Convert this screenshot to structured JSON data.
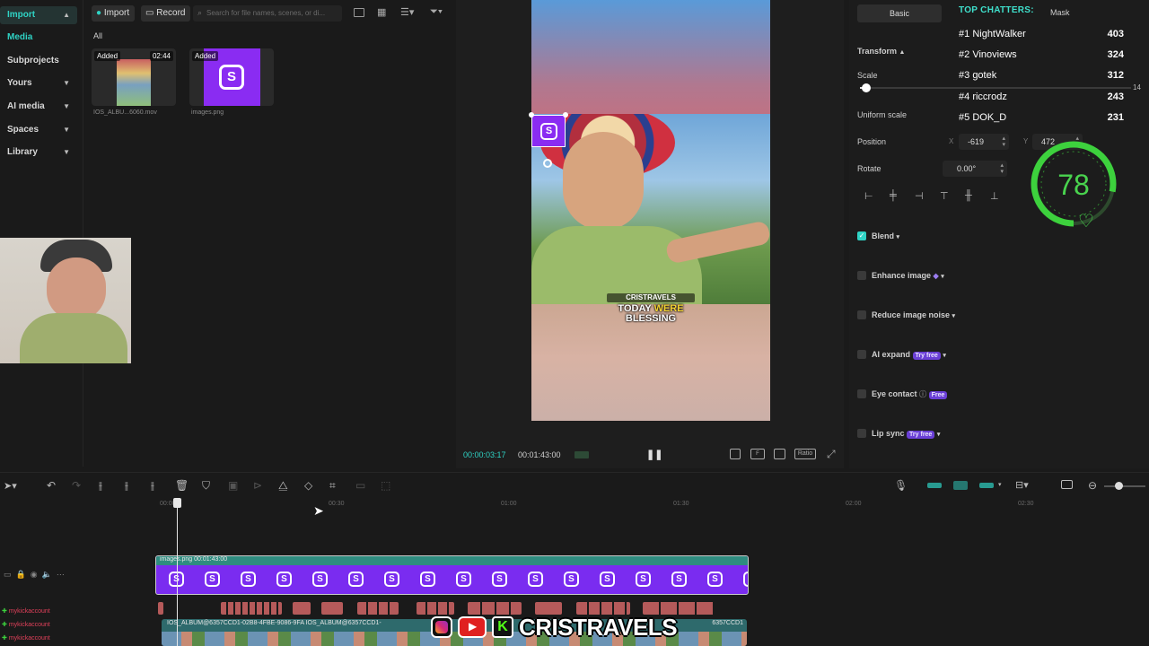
{
  "left_nav": {
    "items": [
      {
        "label": "Import",
        "active": true
      },
      {
        "label": "Media",
        "active": true
      },
      {
        "label": "Subprojects"
      },
      {
        "label": "Yours"
      },
      {
        "label": "AI media"
      },
      {
        "label": "Spaces"
      },
      {
        "label": "Library"
      }
    ]
  },
  "media": {
    "import_label": "Import",
    "record_label": "Record",
    "search_placeholder": "Search for file names, scenes, or di...",
    "filter_label": "All",
    "items": [
      {
        "badge": "Added",
        "duration": "02:44",
        "name": "IOS_ALBU...6060.mov"
      },
      {
        "badge": "Added",
        "duration": "",
        "name": "images.png"
      }
    ]
  },
  "preview": {
    "caption_handle": "CRISTRAVELS",
    "caption_line1a": "TODAY",
    "caption_line1b": "WERE",
    "caption_line2": "BLESSING",
    "current_time": "00:00:03:17",
    "total_time": "00:01:43:00",
    "ratio_label": "Ratio"
  },
  "properties": {
    "tabs": [
      "Basic",
      "Mask"
    ],
    "transform_label": "Transform",
    "scale_label": "Scale",
    "scale_value": "14",
    "uniform_scale_label": "Uniform scale",
    "position_label": "Position",
    "x_label": "X",
    "x_value": "-619",
    "y_label": "Y",
    "y_value": "472",
    "rotate_label": "Rotate",
    "rotate_value": "0.00°",
    "blend_label": "Blend",
    "enhance_label": "Enhance image",
    "noise_label": "Reduce image noise",
    "ai_expand_label": "AI expand",
    "ai_expand_tag": "Try free",
    "eye_label": "Eye contact",
    "eye_tag": "Free",
    "lip_label": "Lip sync",
    "lip_tag": "Try free"
  },
  "chatters": {
    "title": "TOP CHATTERS:",
    "rows": [
      {
        "rank": "#1",
        "name": "NightWalker",
        "score": "403"
      },
      {
        "rank": "#2",
        "name": "Vinoviews",
        "score": "324"
      },
      {
        "rank": "#3",
        "name": "gotek",
        "score": "312"
      },
      {
        "rank": "#4",
        "name": "riccrodz",
        "score": "243"
      },
      {
        "rank": "#5",
        "name": "DOK_D",
        "score": "231"
      }
    ]
  },
  "heart_rate": {
    "value": "78",
    "color": "#3dd13d",
    "fraction": 0.78
  },
  "timeline": {
    "ruler": [
      "00:00",
      "00:30",
      "01:00",
      "01:30",
      "02:00",
      "02:30"
    ],
    "overlay_clip_label": "images.png  00:01:43:00",
    "main_clip_label": "IOS_ALBUM@6357CCD1-02B8-4FBE-9086-9FA  IOS_ALBUM@6357CCD1-",
    "main_clip_label_end": "6357CCD1",
    "accounts": [
      "mykickaccount",
      "mykickaccount",
      "mykickaccount"
    ]
  },
  "branding": {
    "name": "CRISTRAVELS"
  },
  "colors": {
    "accent": "#2fd3c5",
    "clip_purple": "#7a2cf0",
    "ring_green": "#3dd13d",
    "tag_purple": "#6a3fd6"
  }
}
